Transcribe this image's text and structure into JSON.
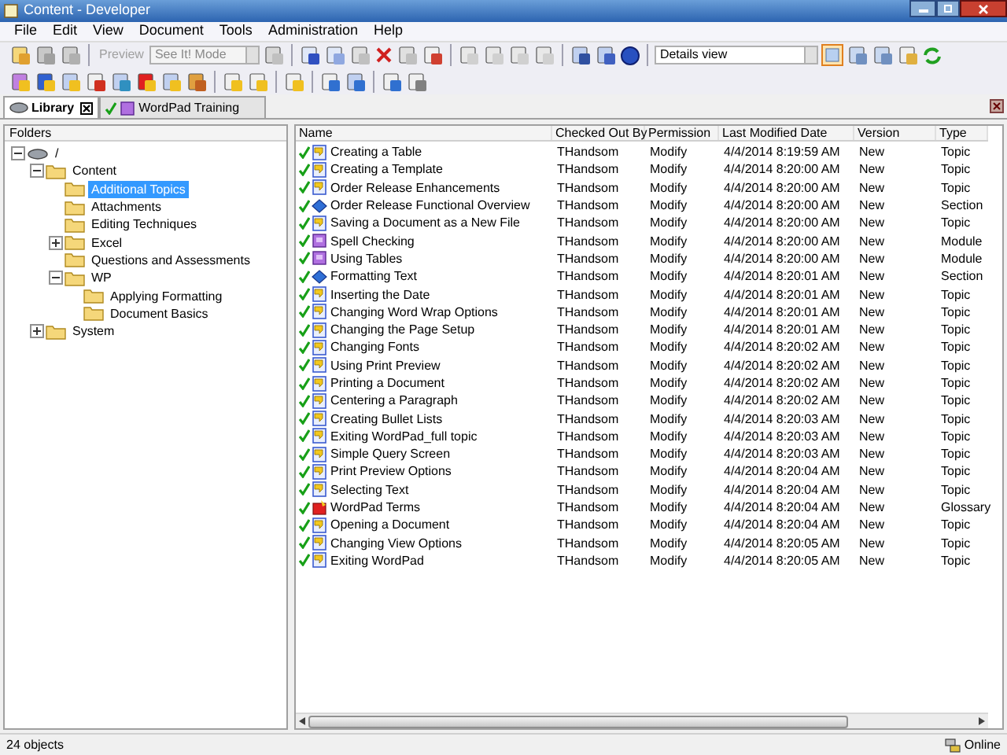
{
  "window": {
    "title": "Content - Developer"
  },
  "menu": [
    "File",
    "Edit",
    "View",
    "Document",
    "Tools",
    "Administration",
    "Help"
  ],
  "toolbar": {
    "preview": {
      "label": "Preview",
      "disabled": true
    },
    "mode_select": {
      "value": "See It! Mode",
      "disabled": true
    },
    "view_select": {
      "value": "Details view"
    }
  },
  "tabs": [
    {
      "label": "Library",
      "selected": true,
      "kind": "library"
    },
    {
      "label": "WordPad Training",
      "selected": false,
      "kind": "outline"
    }
  ],
  "folders": {
    "header": "Folders",
    "tree": [
      {
        "label": "/",
        "kind": "root",
        "expanded": true,
        "selected": false,
        "children": [
          {
            "label": "Content",
            "expanded": true,
            "selected": false,
            "children": [
              {
                "label": "Additional Topics",
                "selected": true
              },
              {
                "label": "Attachments",
                "selected": false
              },
              {
                "label": "Editing Techniques",
                "selected": false
              },
              {
                "label": "Excel",
                "expanded": false,
                "selected": false
              },
              {
                "label": "Questions and Assessments",
                "selected": false
              },
              {
                "label": "WP",
                "expanded": true,
                "selected": false,
                "children": [
                  {
                    "label": "Applying Formatting",
                    "selected": false
                  },
                  {
                    "label": "Document Basics",
                    "selected": false
                  }
                ]
              }
            ]
          },
          {
            "label": "System",
            "expanded": false,
            "selected": false
          }
        ]
      }
    ]
  },
  "table": {
    "columns": [
      "Name",
      "Checked Out By",
      "Permission",
      "Last Modified Date",
      "Version",
      "Type"
    ],
    "rows": [
      {
        "kind": "topic",
        "checked": true,
        "cells": [
          "Creating a Table",
          "THandsom",
          "Modify",
          "4/4/2014 8:19:59 AM",
          "New",
          "Topic"
        ]
      },
      {
        "kind": "topic",
        "checked": true,
        "cells": [
          "Creating a Template",
          "THandsom",
          "Modify",
          "4/4/2014 8:20:00 AM",
          "New",
          "Topic"
        ]
      },
      {
        "kind": "topic",
        "checked": true,
        "cells": [
          "Order Release Enhancements",
          "THandsom",
          "Modify",
          "4/4/2014 8:20:00 AM",
          "New",
          "Topic"
        ]
      },
      {
        "kind": "section",
        "checked": true,
        "cells": [
          "Order Release Functional Overview",
          "THandsom",
          "Modify",
          "4/4/2014 8:20:00 AM",
          "New",
          "Section"
        ]
      },
      {
        "kind": "topic",
        "checked": true,
        "cells": [
          "Saving a Document as a New File",
          "THandsom",
          "Modify",
          "4/4/2014 8:20:00 AM",
          "New",
          "Topic"
        ]
      },
      {
        "kind": "module",
        "checked": true,
        "cells": [
          "Spell Checking",
          "THandsom",
          "Modify",
          "4/4/2014 8:20:00 AM",
          "New",
          "Module"
        ]
      },
      {
        "kind": "module",
        "checked": true,
        "cells": [
          "Using Tables",
          "THandsom",
          "Modify",
          "4/4/2014 8:20:00 AM",
          "New",
          "Module"
        ]
      },
      {
        "kind": "section",
        "checked": true,
        "cells": [
          "Formatting Text",
          "THandsom",
          "Modify",
          "4/4/2014 8:20:01 AM",
          "New",
          "Section"
        ]
      },
      {
        "kind": "topic",
        "checked": true,
        "cells": [
          "Inserting the Date",
          "THandsom",
          "Modify",
          "4/4/2014 8:20:01 AM",
          "New",
          "Topic"
        ]
      },
      {
        "kind": "topic",
        "checked": true,
        "cells": [
          "Changing Word Wrap Options",
          "THandsom",
          "Modify",
          "4/4/2014 8:20:01 AM",
          "New",
          "Topic"
        ]
      },
      {
        "kind": "topic",
        "checked": true,
        "cells": [
          "Changing the Page Setup",
          "THandsom",
          "Modify",
          "4/4/2014 8:20:01 AM",
          "New",
          "Topic"
        ]
      },
      {
        "kind": "topic",
        "checked": true,
        "cells": [
          "Changing Fonts",
          "THandsom",
          "Modify",
          "4/4/2014 8:20:02 AM",
          "New",
          "Topic"
        ]
      },
      {
        "kind": "topic",
        "checked": true,
        "cells": [
          "Using Print Preview",
          "THandsom",
          "Modify",
          "4/4/2014 8:20:02 AM",
          "New",
          "Topic"
        ]
      },
      {
        "kind": "topic",
        "checked": true,
        "cells": [
          "Printing a Document",
          "THandsom",
          "Modify",
          "4/4/2014 8:20:02 AM",
          "New",
          "Topic"
        ]
      },
      {
        "kind": "topic",
        "checked": true,
        "cells": [
          "Centering a Paragraph",
          "THandsom",
          "Modify",
          "4/4/2014 8:20:02 AM",
          "New",
          "Topic"
        ]
      },
      {
        "kind": "topic",
        "checked": true,
        "cells": [
          "Creating Bullet Lists",
          "THandsom",
          "Modify",
          "4/4/2014 8:20:03 AM",
          "New",
          "Topic"
        ]
      },
      {
        "kind": "topic",
        "checked": true,
        "cells": [
          "Exiting WordPad_full topic",
          "THandsom",
          "Modify",
          "4/4/2014 8:20:03 AM",
          "New",
          "Topic"
        ]
      },
      {
        "kind": "topic",
        "checked": true,
        "cells": [
          "Simple Query Screen",
          "THandsom",
          "Modify",
          "4/4/2014 8:20:03 AM",
          "New",
          "Topic"
        ]
      },
      {
        "kind": "topic",
        "checked": true,
        "cells": [
          "Print Preview Options",
          "THandsom",
          "Modify",
          "4/4/2014 8:20:04 AM",
          "New",
          "Topic"
        ]
      },
      {
        "kind": "topic",
        "checked": true,
        "cells": [
          "Selecting Text",
          "THandsom",
          "Modify",
          "4/4/2014 8:20:04 AM",
          "New",
          "Topic"
        ]
      },
      {
        "kind": "glossary",
        "checked": true,
        "cells": [
          "WordPad Terms",
          "THandsom",
          "Modify",
          "4/4/2014 8:20:04 AM",
          "New",
          "Glossary"
        ]
      },
      {
        "kind": "topic",
        "checked": true,
        "cells": [
          "Opening a Document",
          "THandsom",
          "Modify",
          "4/4/2014 8:20:04 AM",
          "New",
          "Topic"
        ]
      },
      {
        "kind": "topic",
        "checked": true,
        "cells": [
          "Changing View Options",
          "THandsom",
          "Modify",
          "4/4/2014 8:20:05 AM",
          "New",
          "Topic"
        ]
      },
      {
        "kind": "topic",
        "checked": true,
        "cells": [
          "Exiting WordPad",
          "THandsom",
          "Modify",
          "4/4/2014 8:20:05 AM",
          "New",
          "Topic"
        ]
      }
    ]
  },
  "status_bar": {
    "count": "24 objects",
    "connection": "Online"
  }
}
